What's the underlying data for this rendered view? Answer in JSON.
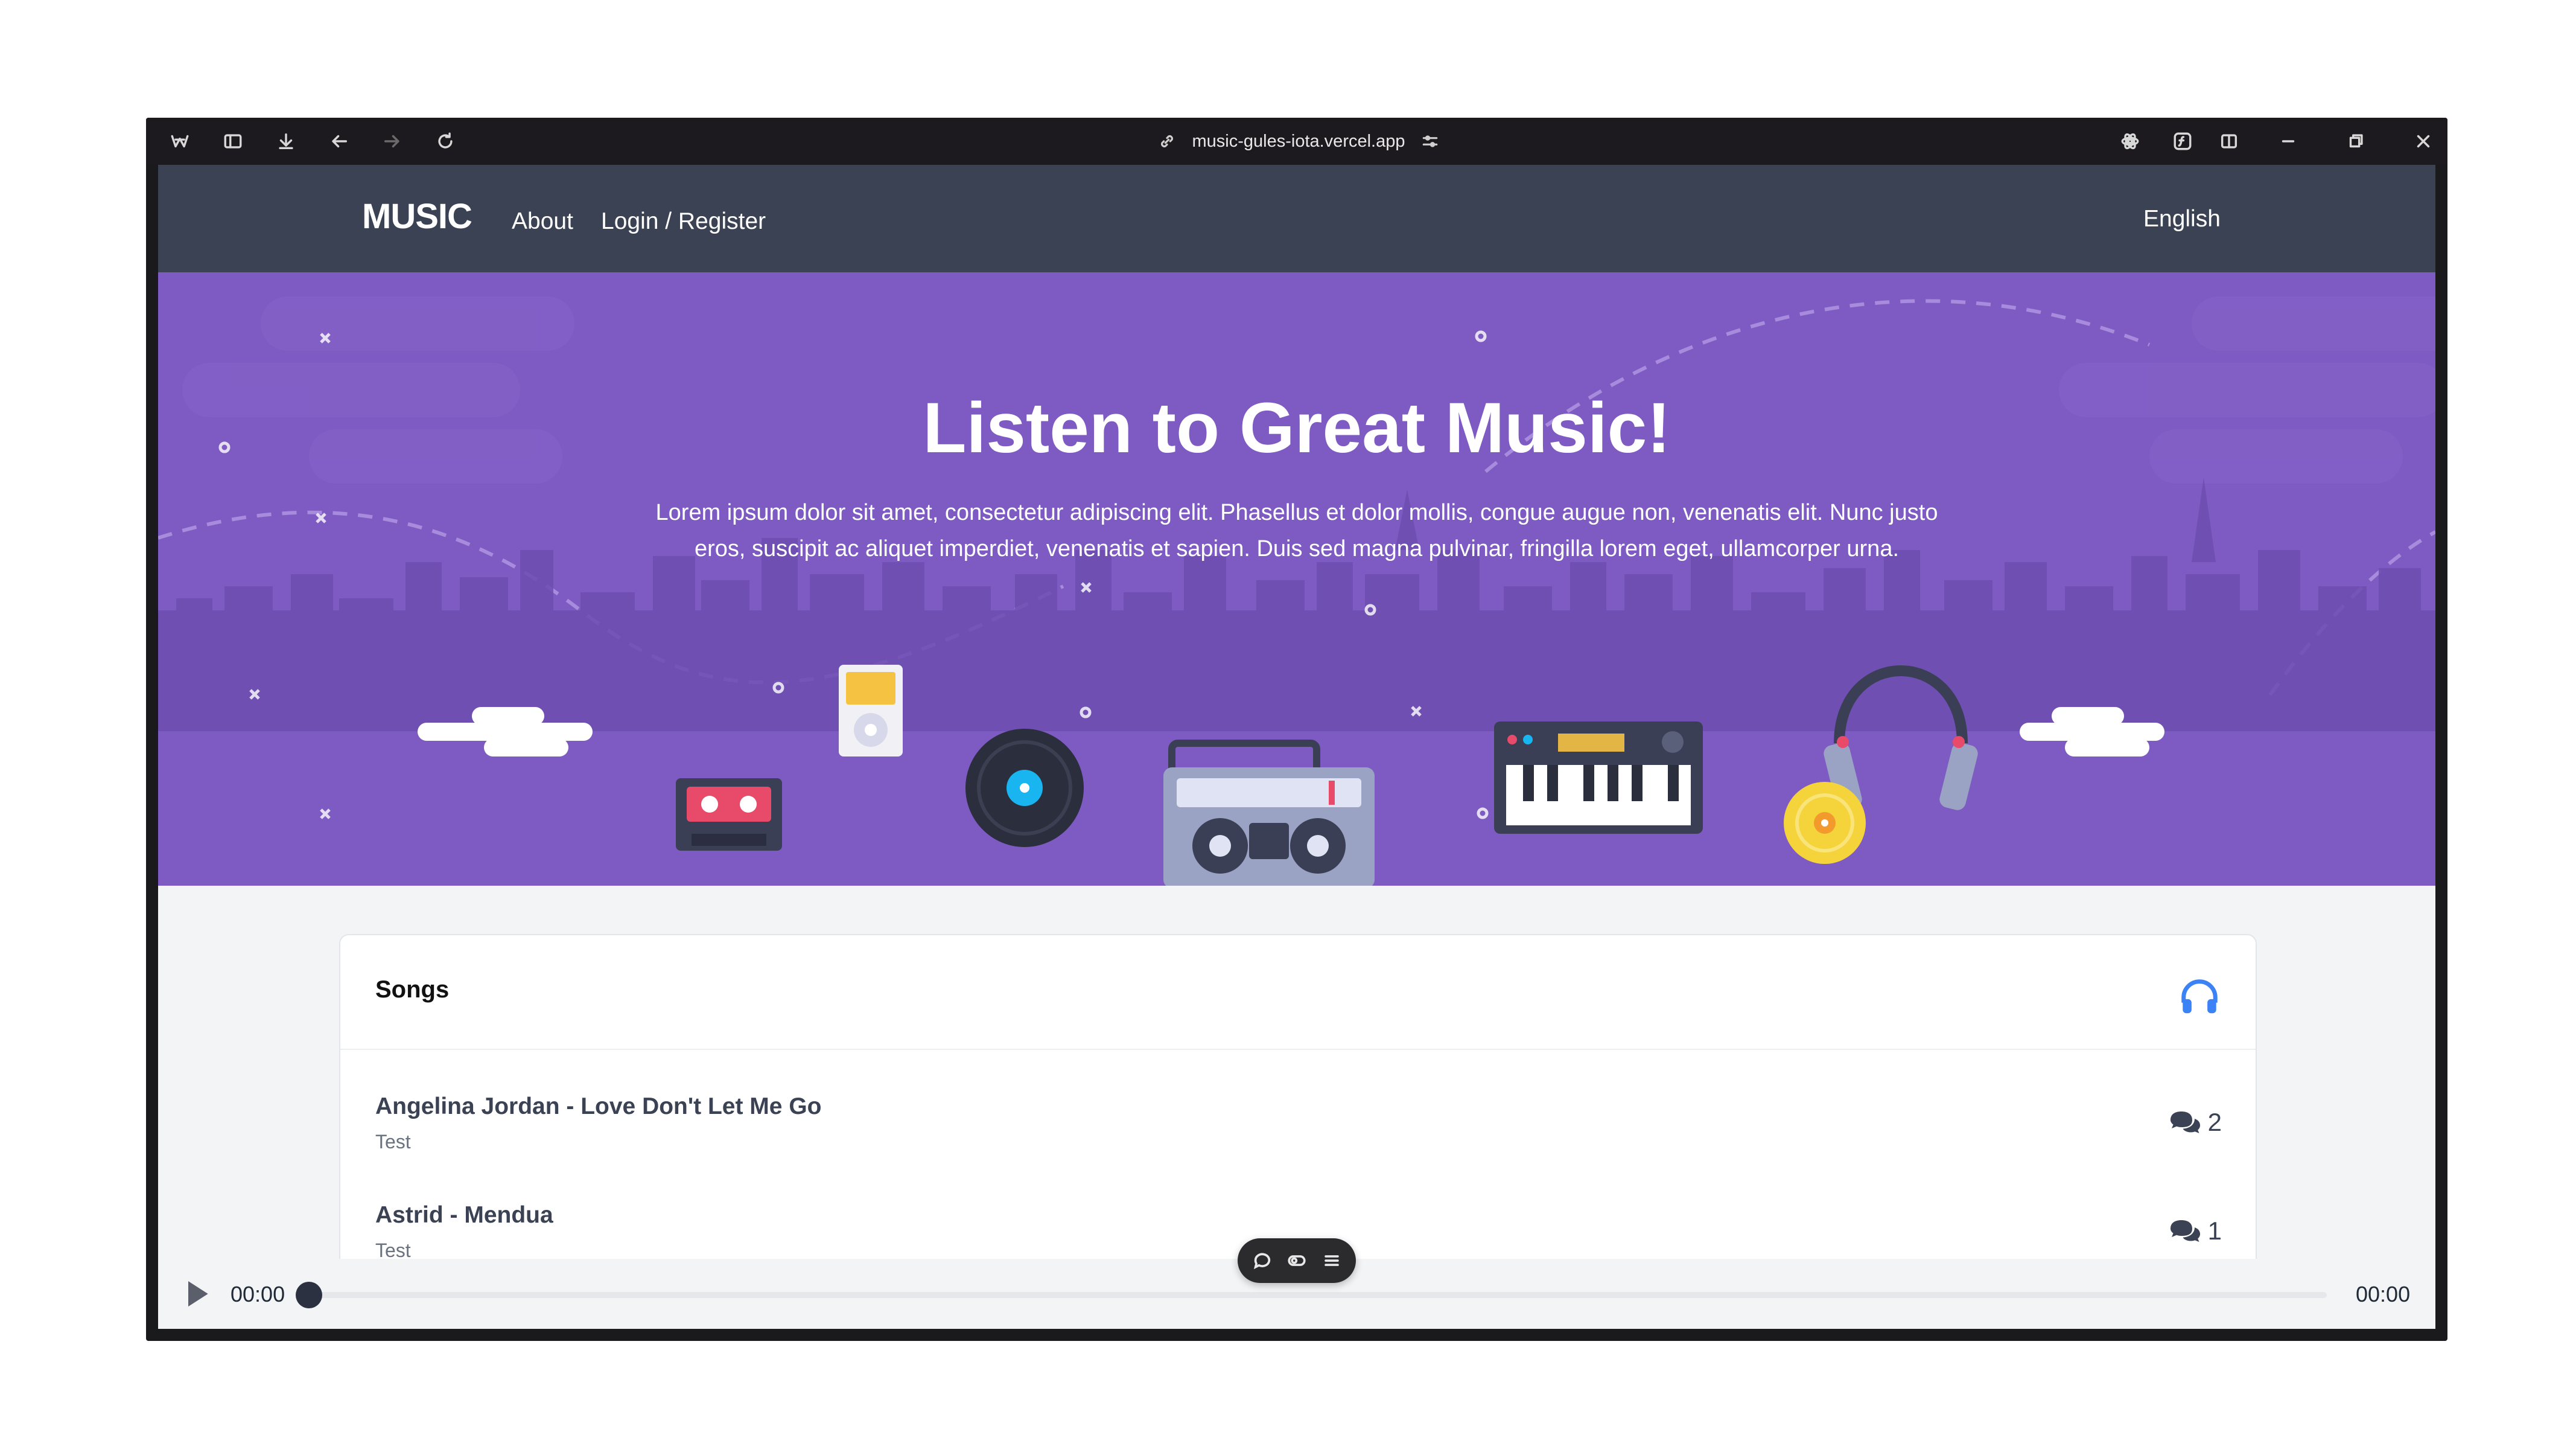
{
  "browser": {
    "url": "music-gules-iota.vercel.app"
  },
  "navbar": {
    "brand": "MUSIC",
    "about": "About",
    "login": "Login / Register",
    "language": "English"
  },
  "hero": {
    "title": "Listen to Great Music!",
    "text": "Lorem ipsum dolor sit amet, consectetur adipiscing elit. Phasellus et dolor mollis, congue augue non, venenatis elit. Nunc justo eros, suscipit ac aliquet imperdiet, venenatis et sapien. Duis sed magna pulvinar, fringilla lorem eget, ullamcorper urna."
  },
  "songs": {
    "title": "Songs",
    "icon": "headphones-icon",
    "items": [
      {
        "title": "Angelina Jordan - Love Don't Let Me Go",
        "subtitle": "Test",
        "comments": "2"
      },
      {
        "title": "Astrid - Mendua",
        "subtitle": "Test",
        "comments": "1"
      }
    ]
  },
  "player": {
    "current_time": "00:00",
    "total_time": "00:00",
    "progress": 0
  },
  "colors": {
    "navbar": "#3a4253",
    "hero": "#7e5bc2",
    "accent": "#3b82f6"
  }
}
